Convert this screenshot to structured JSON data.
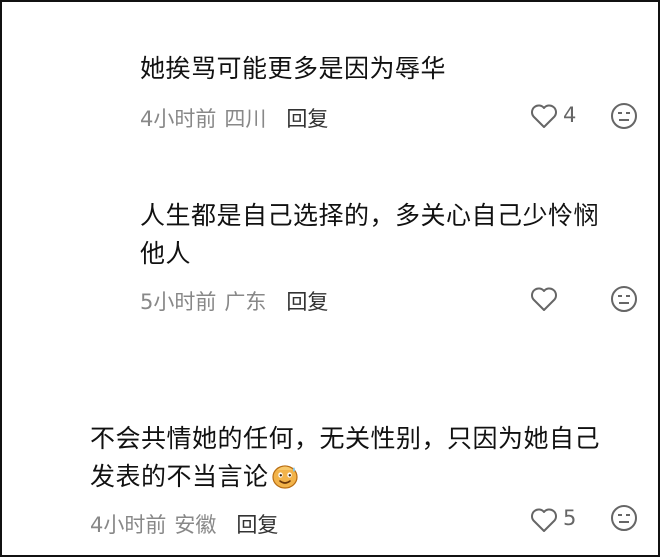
{
  "comments": [
    {
      "text_lines": [
        "她挨骂可能更多是因为辱华"
      ],
      "time": "4小时前",
      "location": "四川",
      "reply_label": "回复",
      "likes": "4"
    },
    {
      "text_lines": [
        "人生都是自己选择的，多关心自己少怜悯",
        "他人"
      ],
      "time": "5小时前",
      "location": "广东",
      "reply_label": "回复",
      "likes": ""
    },
    {
      "text_lines": [
        "不会共情她的任何，无关性别，只因为她自己",
        "发表的不当言论"
      ],
      "time": "4小时前",
      "location": "安徽",
      "reply_label": "回复",
      "likes": "5"
    }
  ],
  "icons": {
    "like": "heart-outline-icon",
    "dislike": "meh-face-icon",
    "emoji": "sweat-smile-emoji"
  },
  "colors": {
    "text": "#111111",
    "meta": "#888888",
    "icon": "#666666"
  }
}
